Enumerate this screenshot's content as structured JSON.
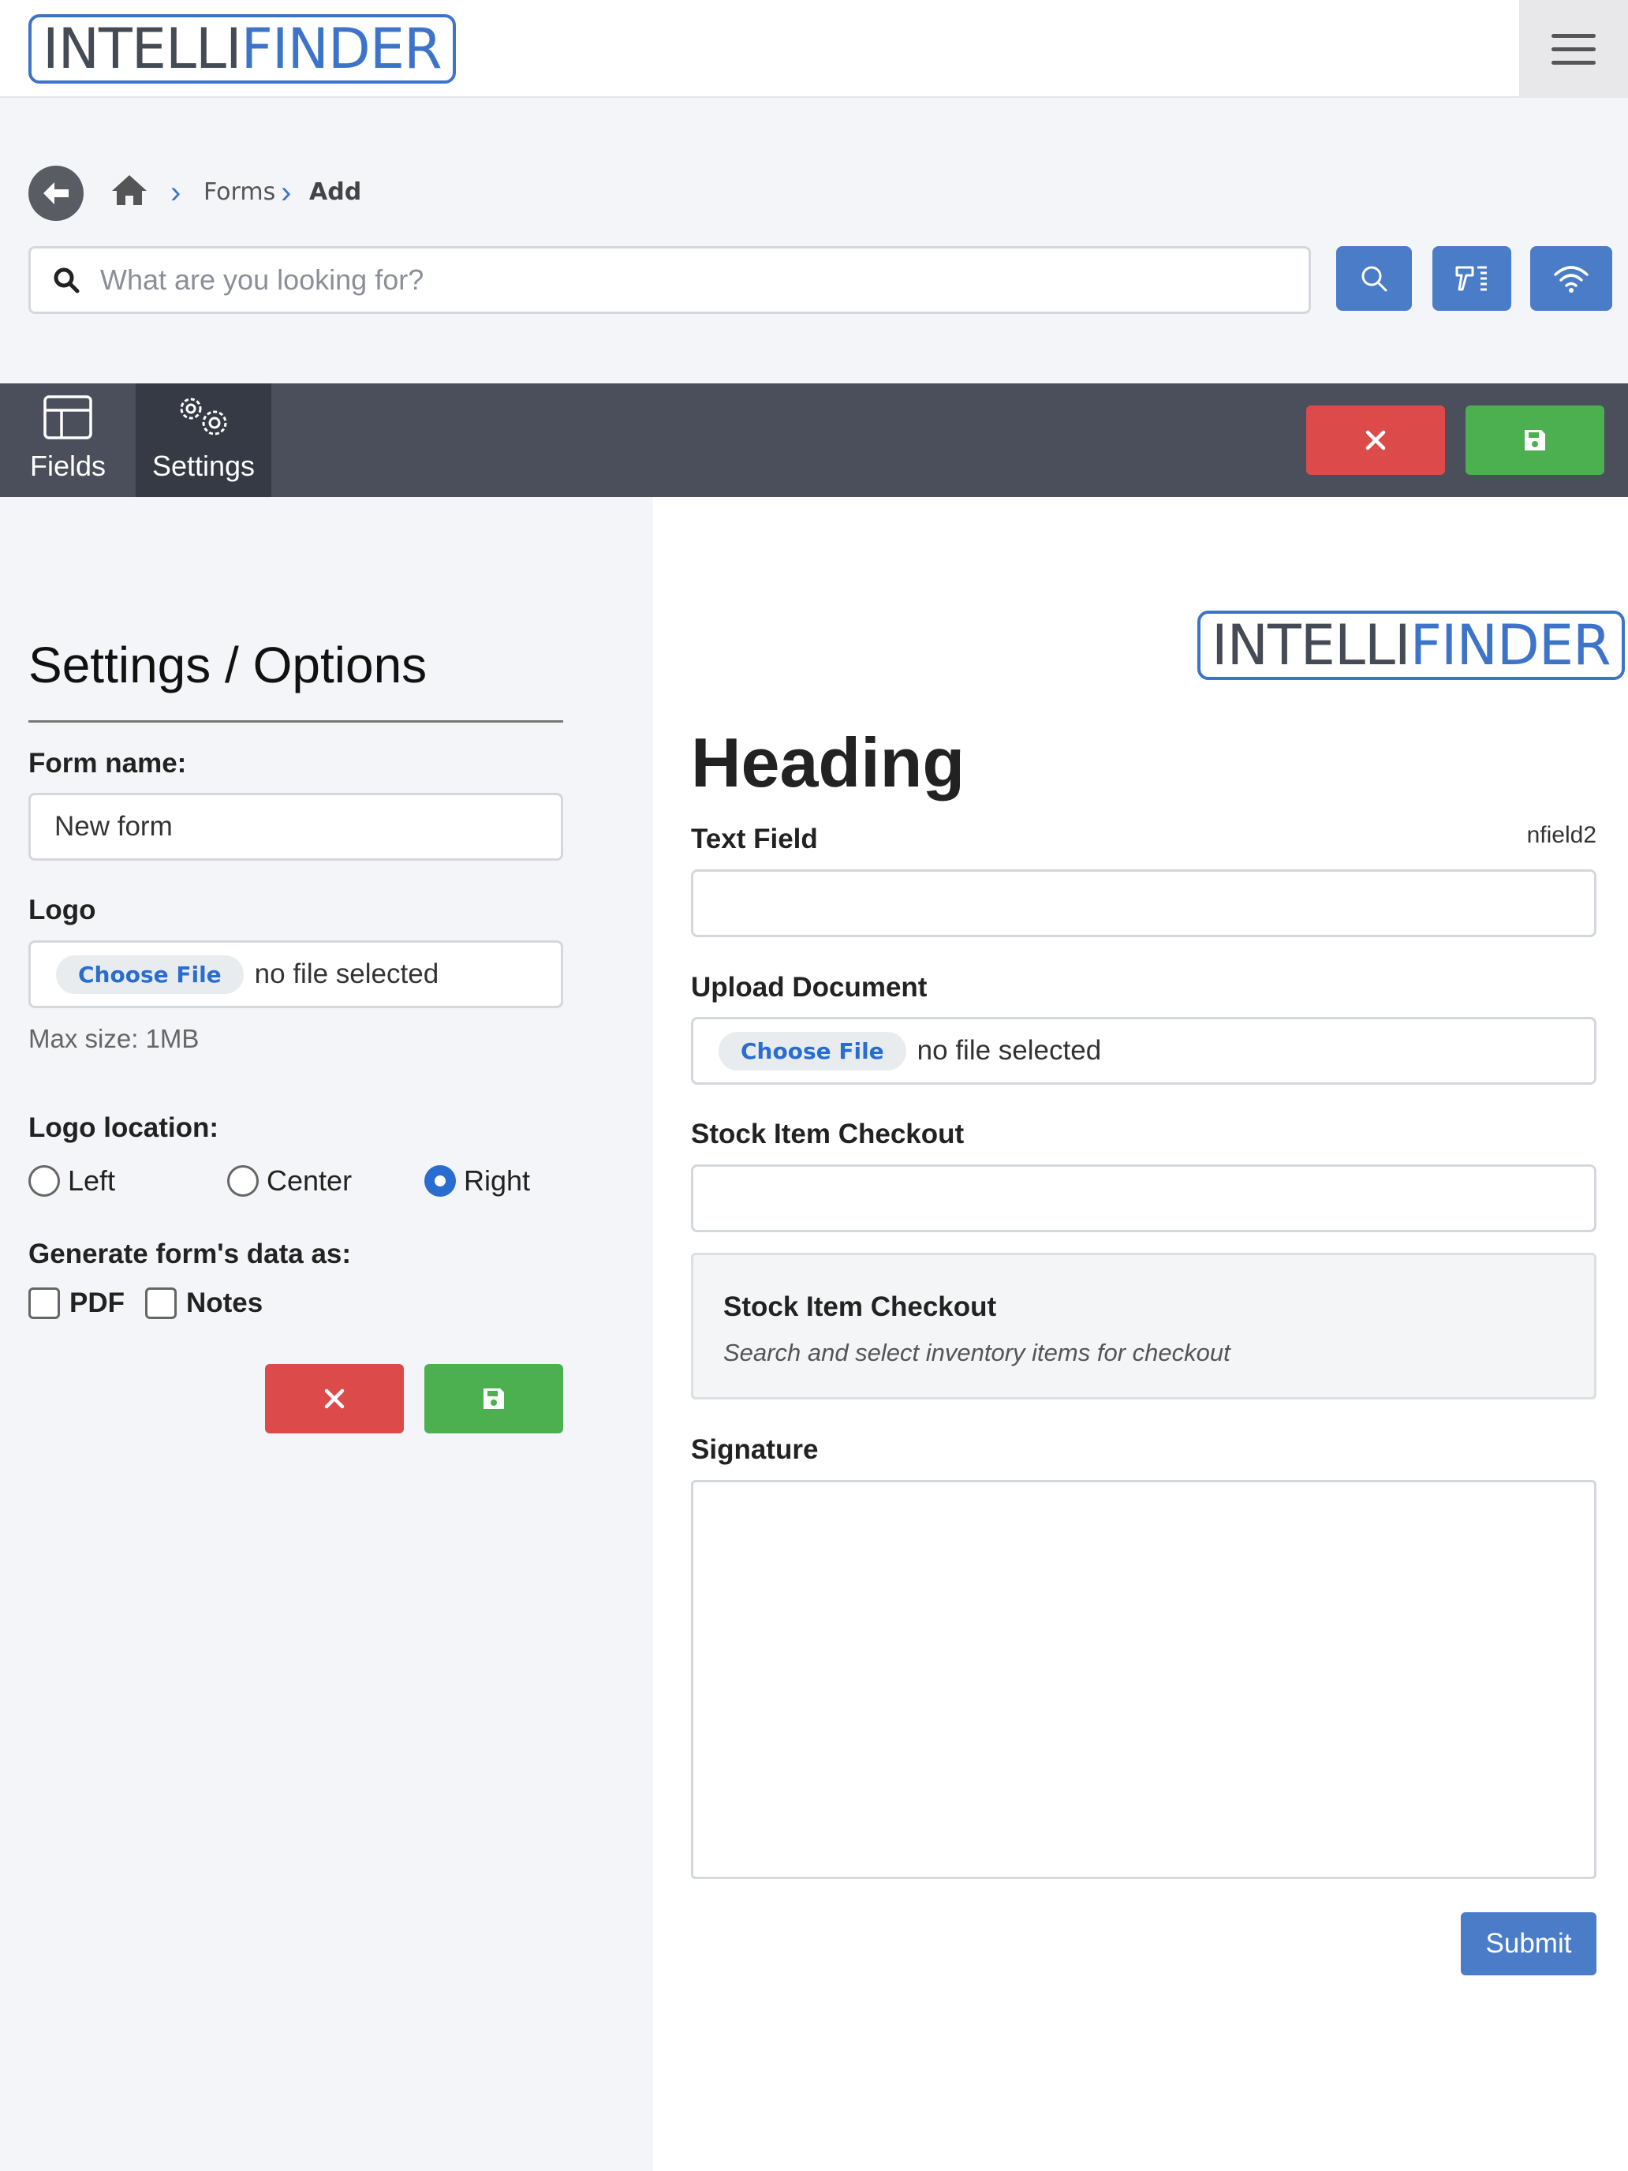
{
  "header": {
    "logo": {
      "part1": "INTELLI",
      "part2": "FINDER"
    },
    "menu_icon": "hamburger-icon"
  },
  "breadcrumb": {
    "items": [
      "Forms",
      "Add"
    ]
  },
  "search": {
    "placeholder": "What are you looking for?",
    "value": ""
  },
  "toolbar": {
    "tabs": [
      {
        "label": "Fields",
        "icon": "layout-icon",
        "active": false
      },
      {
        "label": "Settings",
        "icon": "gears-icon",
        "active": true
      }
    ]
  },
  "settings": {
    "title": "Settings / Options",
    "form_name_label": "Form name:",
    "form_name_value": "New form",
    "logo_label": "Logo",
    "choose_file_label": "Choose File",
    "no_file_text": "no file selected",
    "max_size": "Max size: 1MB",
    "logo_location_label": "Logo location:",
    "logo_location_options": [
      "Left",
      "Center",
      "Right"
    ],
    "logo_location_selected": "Right",
    "generate_label": "Generate form's data as:",
    "generate_options": [
      "PDF",
      "Notes"
    ]
  },
  "preview": {
    "logo": {
      "part1": "INTELLI",
      "part2": "FINDER"
    },
    "heading": "Heading",
    "text_field_label": "Text Field",
    "text_field_id": "nfield2",
    "upload_label": "Upload Document",
    "choose_file_label": "Choose File",
    "no_file_text": "no file selected",
    "stock_label": "Stock Item Checkout",
    "stock_card_title": "Stock Item Checkout",
    "stock_card_desc": "Search and select inventory items for checkout",
    "signature_label": "Signature",
    "submit_label": "Submit"
  },
  "colors": {
    "brand_blue": "#3d74c9",
    "button_blue": "#4a7cc7",
    "danger": "#dc4a4a",
    "success": "#4cb050",
    "toolbar": "#4b4f5c"
  }
}
